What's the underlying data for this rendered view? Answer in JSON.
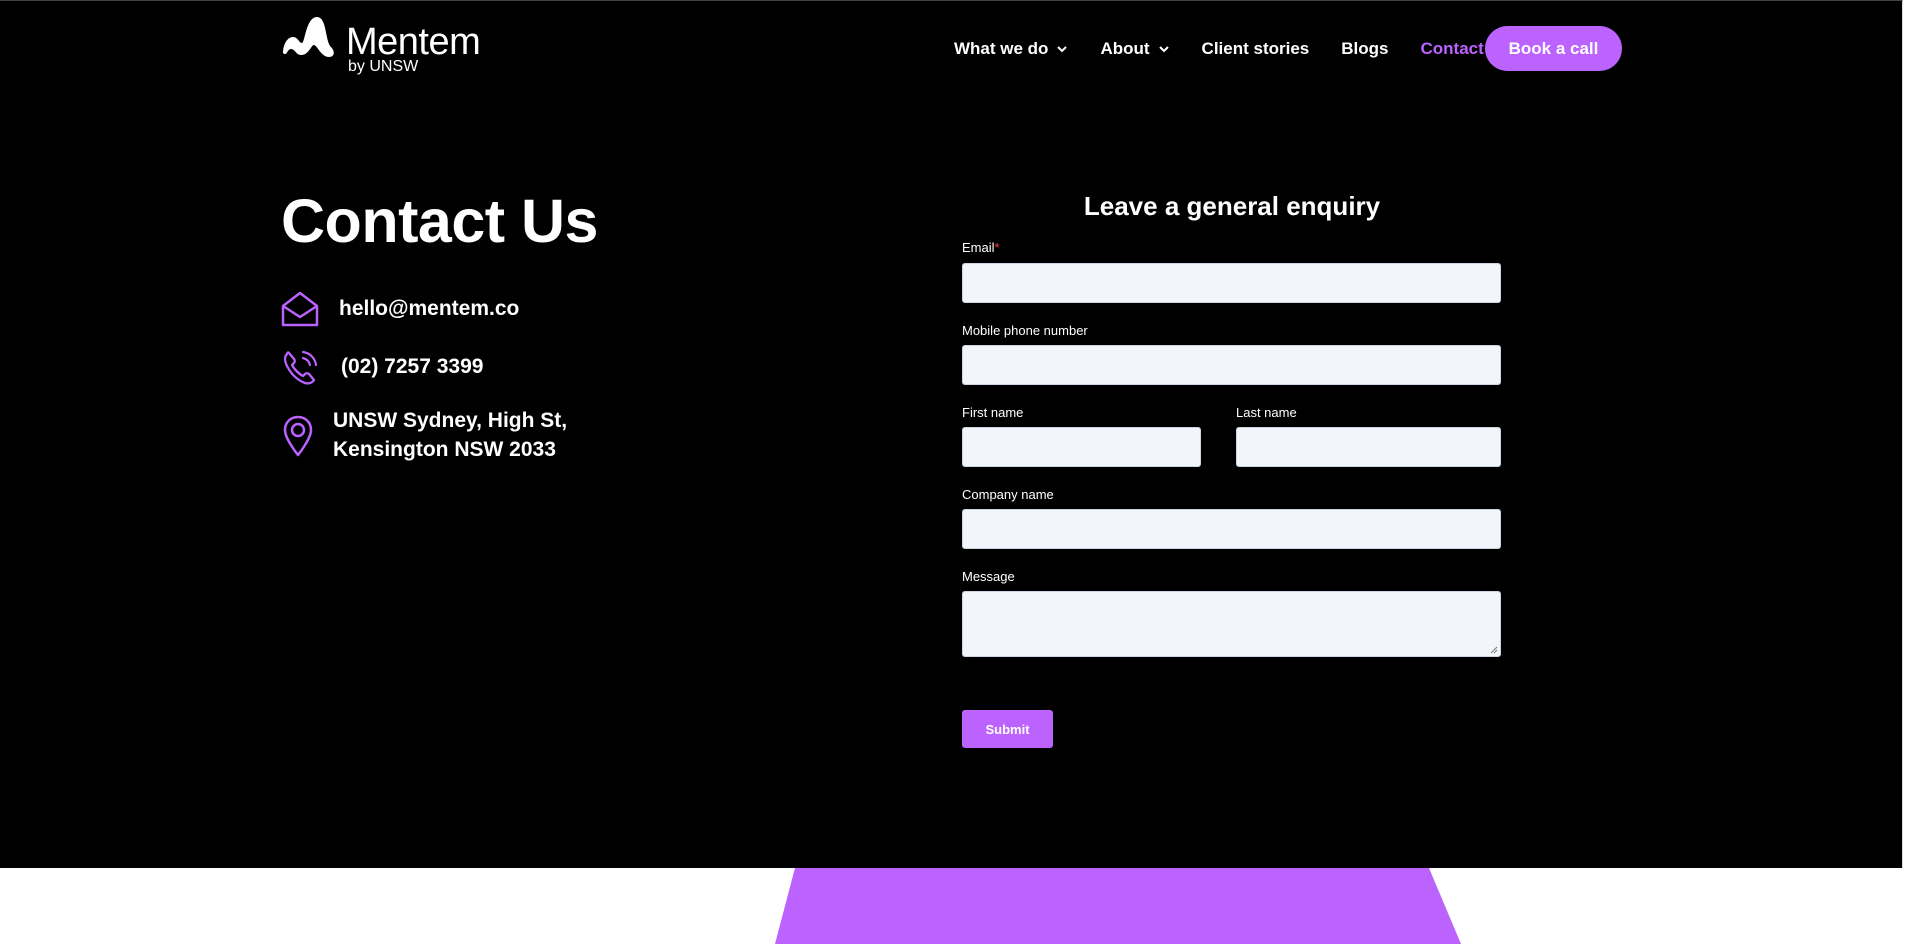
{
  "brand": {
    "name": "Mentem",
    "sub": "by UNSW"
  },
  "nav": {
    "items": [
      {
        "label": "What we do",
        "dropdown": true
      },
      {
        "label": "About",
        "dropdown": true
      },
      {
        "label": "Client stories",
        "dropdown": false
      },
      {
        "label": "Blogs",
        "dropdown": false
      },
      {
        "label": "Contact",
        "dropdown": false,
        "active": true
      }
    ],
    "cta": "Book a call"
  },
  "contact": {
    "title": "Contact Us",
    "email": "hello@mentem.co",
    "phone": "(02) 7257 3399",
    "address_line1": "UNSW Sydney, High St,",
    "address_line2": "Kensington NSW 2033"
  },
  "form": {
    "title": "Leave a general enquiry",
    "email_label": "Email",
    "required_mark": "*",
    "mobile_label": "Mobile phone number",
    "first_name_label": "First name",
    "last_name_label": "Last name",
    "company_label": "Company name",
    "message_label": "Message",
    "submit": "Submit"
  },
  "colors": {
    "accent": "#bb62ff",
    "background": "#000000",
    "field_bg": "#f2f6fa"
  }
}
